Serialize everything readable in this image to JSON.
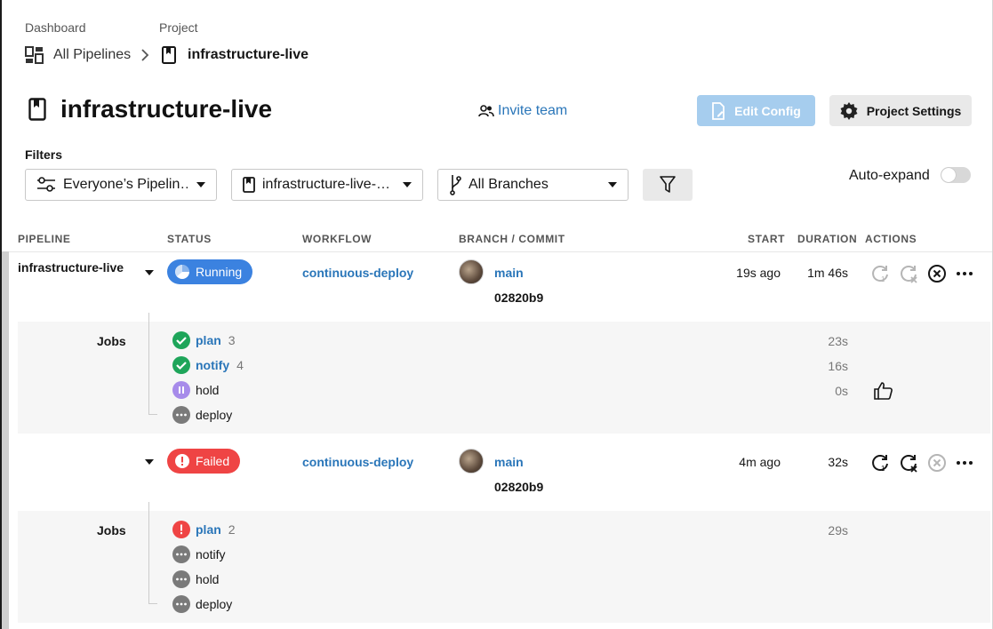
{
  "breadcrumb": {
    "dashboard_label": "Dashboard",
    "project_label": "Project",
    "all_pipelines": "All Pipelines",
    "project_name": "infrastructure-live"
  },
  "header": {
    "title": "infrastructure-live",
    "invite_team": "Invite team",
    "edit_config": "Edit Config",
    "project_settings": "Project Settings"
  },
  "filters": {
    "label": "Filters",
    "pipelines_select": "Everyone’s Pipelin…",
    "project_select": "infrastructure-live-…",
    "branches_select": "All Branches",
    "auto_expand_label": "Auto-expand",
    "auto_expand_on": false
  },
  "table": {
    "headers": {
      "pipeline": "PIPELINE",
      "status": "STATUS",
      "workflow": "WORKFLOW",
      "branch_commit": "BRANCH / COMMIT",
      "start": "START",
      "duration": "DURATION",
      "actions": "ACTIONS"
    },
    "rows": [
      {
        "pipeline": "infrastructure-live",
        "status": "Running",
        "workflow": "continuous-deploy",
        "branch": "main",
        "commit": "02820b9",
        "start": "19s ago",
        "duration": "1m 46s",
        "jobs_label": "Jobs",
        "jobs": [
          {
            "name": "plan",
            "num": "3",
            "status": "success",
            "duration": "23s"
          },
          {
            "name": "notify",
            "num": "4",
            "status": "success",
            "duration": "16s"
          },
          {
            "name": "hold",
            "num": "",
            "status": "on-hold",
            "duration": "0s"
          },
          {
            "name": "deploy",
            "num": "",
            "status": "blocked",
            "duration": ""
          }
        ]
      },
      {
        "pipeline": "",
        "status": "Failed",
        "workflow": "continuous-deploy",
        "branch": "main",
        "commit": "02820b9",
        "start": "4m ago",
        "duration": "32s",
        "jobs_label": "Jobs",
        "jobs": [
          {
            "name": "plan",
            "num": "2",
            "status": "failed",
            "duration": "29s"
          },
          {
            "name": "notify",
            "num": "",
            "status": "blocked",
            "duration": ""
          },
          {
            "name": "hold",
            "num": "",
            "status": "blocked",
            "duration": ""
          },
          {
            "name": "deploy",
            "num": "",
            "status": "blocked",
            "duration": ""
          }
        ]
      }
    ]
  },
  "colors": {
    "link": "#2a76b9",
    "running": "#3b82e0",
    "failed": "#ef4444",
    "success": "#1ea55a",
    "on_hold": "#a78bea",
    "blocked": "#7a7a7a"
  }
}
